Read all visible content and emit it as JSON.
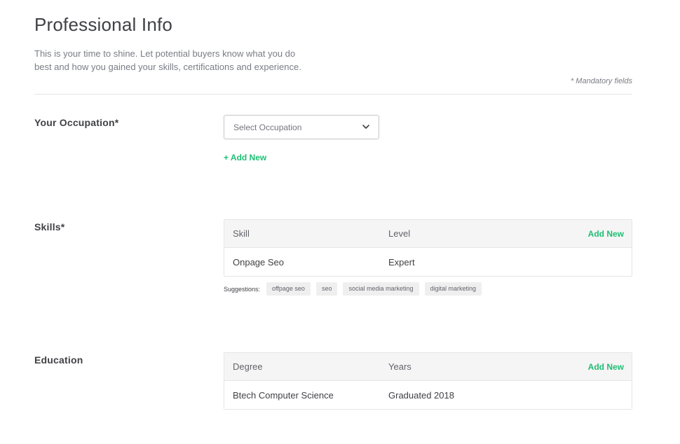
{
  "header": {
    "title": "Professional Info",
    "subtitle": "This is your time to shine. Let potential buyers know what you do best and how you gained your skills, certifications and experience.",
    "mandatory_note": "* Mandatory fields"
  },
  "occupation": {
    "label": "Your Occupation*",
    "select_placeholder": "Select Occupation",
    "add_new_label": "+ Add New"
  },
  "skills": {
    "label": "Skills*",
    "columns": [
      "Skill",
      "Level"
    ],
    "add_new_label": "Add New",
    "rows": [
      {
        "skill": "Onpage Seo",
        "level": "Expert"
      }
    ],
    "suggestions_label": "Suggestions:",
    "suggestions": [
      "offpage seo",
      "seo",
      "social media marketing",
      "digital marketing"
    ]
  },
  "education": {
    "label": "Education",
    "columns": [
      "Degree",
      "Years"
    ],
    "add_new_label": "Add New",
    "rows": [
      {
        "degree": "Btech Computer Science",
        "years": "Graduated 2018"
      }
    ]
  },
  "colors": {
    "accent": "#1dbf73",
    "text": "#404145",
    "muted": "#7a7d85"
  },
  "icons": {
    "select_chevron": "chevron-down-icon"
  }
}
